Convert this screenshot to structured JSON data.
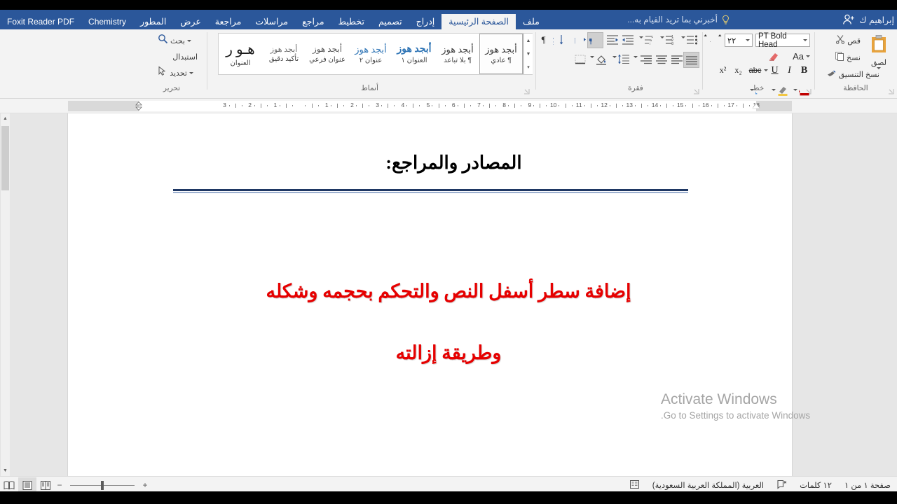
{
  "titlebar": {
    "account_name": "إبراهيم ك",
    "account_icon": "person-add-icon",
    "tell_me": "أخبرني بما تريد القيام به...",
    "tell_me_icon": "lightbulb-icon"
  },
  "ribbon": {
    "tabs": [
      {
        "label": "ملف",
        "active": false,
        "latin": false
      },
      {
        "label": "الصفحة الرئيسية",
        "active": true,
        "latin": false
      },
      {
        "label": "إدراج",
        "active": false,
        "latin": false
      },
      {
        "label": "تصميم",
        "active": false,
        "latin": false
      },
      {
        "label": "تخطيط",
        "active": false,
        "latin": false
      },
      {
        "label": "مراجع",
        "active": false,
        "latin": false
      },
      {
        "label": "مراسلات",
        "active": false,
        "latin": false
      },
      {
        "label": "مراجعة",
        "active": false,
        "latin": false
      },
      {
        "label": "عرض",
        "active": false,
        "latin": false
      },
      {
        "label": "المطور",
        "active": false,
        "latin": false
      },
      {
        "label": "Chemistry",
        "active": false,
        "latin": true
      },
      {
        "label": "Foxit Reader PDF",
        "active": false,
        "latin": true
      }
    ],
    "groups": {
      "clipboard": {
        "label": "الحافظة",
        "paste": "لصق",
        "cut": "قص",
        "copy": "نسخ",
        "format_painter": "نسخ التنسيق"
      },
      "font": {
        "label": "خط",
        "font_name": "PT Bold Head",
        "font_size": "٢٢",
        "bold": "B",
        "italic": "I",
        "underline": "U",
        "strikethrough": "abc",
        "subscript": "x₂",
        "superscript": "x²",
        "grow_font": "A",
        "shrink_font": "A",
        "change_case": "Aa",
        "clear_formatting": "مسح التنسيق",
        "text_effects": "A",
        "highlight": "ab",
        "font_color": "A"
      },
      "paragraph": {
        "label": "فقرة",
        "bullets": "نقاط",
        "numbering": "ترقيم",
        "multilevel": "قائمة متعددة المستويات",
        "decrease_indent": "إنقاص المسافة البادئة",
        "increase_indent": "زيادة المسافة البادئة",
        "rtl": "اتجاه النص من اليمين إلى اليسار",
        "ltr": "اتجاه النص من اليسار إلى اليمين",
        "sort": "فرز",
        "show_marks": "¶",
        "align_right": "محاذاة لليمين",
        "align_center": "توسيط",
        "align_left": "محاذاة لليسار",
        "justify": "ضبط",
        "line_spacing": "تباعد الأسطر",
        "shading": "تظليل",
        "borders": "حدود"
      },
      "styles": {
        "label": "أنماط",
        "items": [
          {
            "sample": "أبجد هوز",
            "name": "¶ عادي",
            "selected": true,
            "color": "#3a3a3a",
            "size": "13px",
            "bold": false
          },
          {
            "sample": "أبجد هوز",
            "name": "¶ بلا تباعد",
            "selected": false,
            "color": "#3a3a3a",
            "size": "13px",
            "bold": false
          },
          {
            "sample": "أبجد هوز",
            "name": "العنوان ١",
            "selected": false,
            "color": "#2e74b5",
            "size": "14px",
            "bold": true
          },
          {
            "sample": "أبجد هوز",
            "name": "عنوان ٢",
            "selected": false,
            "color": "#2e74b5",
            "size": "13px",
            "bold": false
          },
          {
            "sample": "أبجد هوز",
            "name": "عنوان فرعي",
            "selected": false,
            "color": "#5a5a5a",
            "size": "12px",
            "bold": false
          },
          {
            "sample": "أبجد هوز",
            "name": "تأكيد دقيق",
            "selected": false,
            "color": "#6a6a6a",
            "size": "11px",
            "bold": false
          },
          {
            "sample": "هـو ر",
            "name": "العنوان",
            "selected": false,
            "color": "#1a1a1a",
            "size": "20px",
            "bold": false
          }
        ]
      },
      "editing": {
        "label": "تحرير",
        "find": "بحث",
        "replace": "استبدال",
        "select": "تحديد"
      }
    }
  },
  "ruler": {
    "ticks_right": [
      "18",
      "17",
      "16",
      "15",
      "14",
      "13",
      "12",
      "11",
      "10",
      "9",
      "8",
      "7",
      "6",
      "5",
      "4",
      "3",
      "2",
      "1"
    ],
    "ticks_left": [
      "1",
      "2",
      "3"
    ]
  },
  "document": {
    "heading": "المصادر والمراجع:",
    "body_lines": [
      "إضافة سطر أسفل النص والتحكم بحجمه وشكله",
      "وطريقة إزالته"
    ],
    "rule_color_top": "#1f3864",
    "rule_color_bottom": "#9cb0cf"
  },
  "watermark": {
    "title": "Activate Windows",
    "subtitle": "Go to Settings to activate Windows."
  },
  "status": {
    "page": "صفحة ١ من ١",
    "words": "١٢ كلمات",
    "proofing_icon": "proofing-errors-icon",
    "language": "العربية (المملكة العربية السعودية)",
    "accessibility_icon": "accessibility-check-icon",
    "views": [
      {
        "name": "read-mode",
        "active": false
      },
      {
        "name": "print-layout",
        "active": true
      },
      {
        "name": "web-layout",
        "active": false
      }
    ],
    "zoom_out": "−",
    "zoom_in": "+"
  }
}
